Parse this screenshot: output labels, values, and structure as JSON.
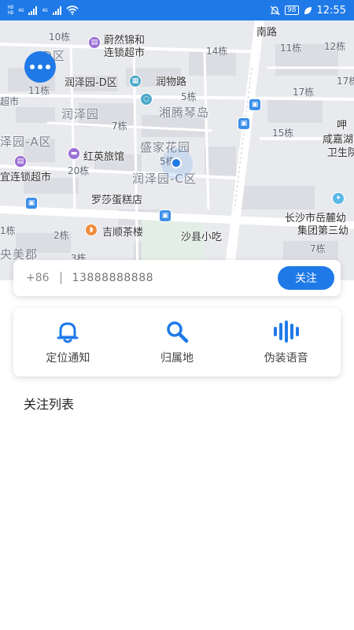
{
  "status_bar": {
    "sim1": "HD",
    "sim2": "HD",
    "net1": "4G",
    "net2": "4G",
    "battery": "98",
    "time": "12:55"
  },
  "map": {
    "labels": [
      "10栋",
      "蔚然锦和",
      "连锁超市",
      "14栋",
      "南路",
      "11栋",
      "12栋",
      "-D区",
      "润泽园-D区",
      "润物路",
      "超市",
      "11栋",
      "5栋",
      "17栋",
      "17栋",
      "润泽园",
      "湘腾琴岛",
      "7栋",
      "呷",
      "15栋",
      "咸嘉湖",
      "卫生院",
      "泽园-A区",
      "红英旅馆",
      "盛家花园",
      "5栋",
      "20栋",
      "宜连锁超市",
      "润泽园-C区",
      "罗莎蛋糕店",
      "长沙市岳麓幼",
      "集团第三幼",
      "1栋",
      "2栋",
      "吉顺茶楼",
      "沙县小吃",
      "央美郡",
      "3栋",
      "7栋"
    ]
  },
  "phone_input": {
    "country_code": "+86",
    "placeholder": "13888888888",
    "follow_label": "关注"
  },
  "functions": [
    {
      "label": "定位通知",
      "icon": "bell-icon"
    },
    {
      "label": "归属地",
      "icon": "search-icon"
    },
    {
      "label": "伪装语音",
      "icon": "voice-wave-icon"
    }
  ],
  "follow_list": {
    "title": "关注列表"
  },
  "colors": {
    "primary": "#1f7ae8",
    "map_bg": "#e9eaee"
  }
}
